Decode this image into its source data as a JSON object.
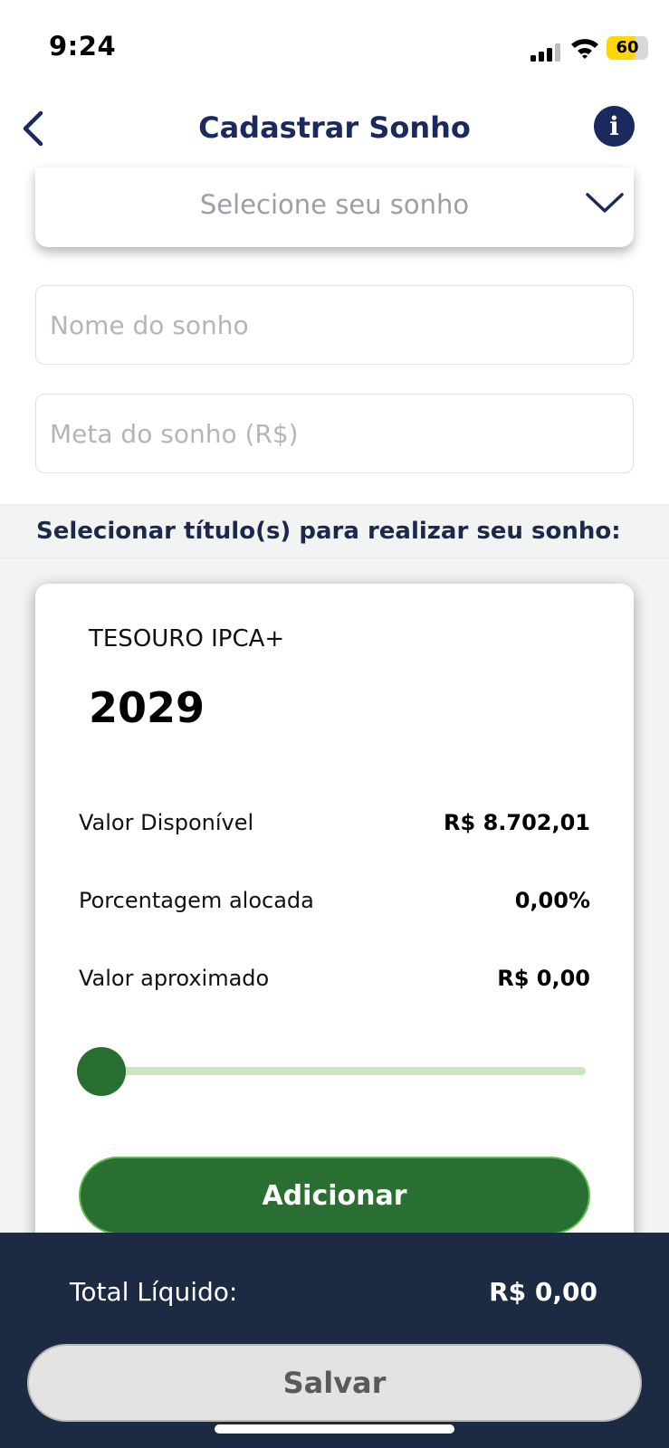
{
  "status_bar": {
    "time": "9:24",
    "battery": "60"
  },
  "header": {
    "title": "Cadastrar Sonho"
  },
  "form": {
    "dream_select_placeholder": "Selecione seu sonho",
    "dream_name_placeholder": "Nome do sonho",
    "dream_goal_placeholder": "Meta do sonho (R$)"
  },
  "section": {
    "title": "Selecionar título(s) para realizar seu sonho:"
  },
  "title_card": {
    "type": "TESOURO IPCA+",
    "year": "2029",
    "rows": [
      {
        "label": "Valor Disponível",
        "value": "R$ 8.702,01"
      },
      {
        "label": "Porcentagem alocada",
        "value": "0,00%"
      },
      {
        "label": "Valor aproximado",
        "value": "R$ 0,00"
      }
    ],
    "slider_value_percent": 0,
    "add_label": "Adicionar"
  },
  "footer": {
    "total_label": "Total Líquido:",
    "total_value": "R$ 0,00",
    "save_label": "Salvar"
  },
  "colors": {
    "primary_navy": "#1b2a5e",
    "footer_navy": "#1c2a44",
    "accent_green": "#2a6f32",
    "slider_track": "#c8e6c0"
  }
}
